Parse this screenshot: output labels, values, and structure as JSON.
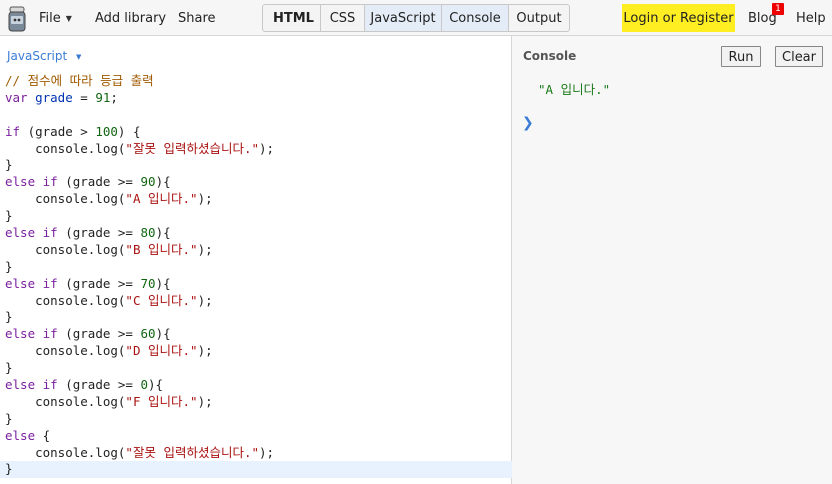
{
  "menu": {
    "file": "File",
    "add_library": "Add library",
    "share": "Share",
    "login": "Login or Register",
    "blog": "Blog",
    "blog_badge": "1",
    "help": "Help"
  },
  "tabs": [
    {
      "label": "HTML"
    },
    {
      "label": "CSS"
    },
    {
      "label": "JavaScript"
    },
    {
      "label": "Console"
    },
    {
      "label": "Output"
    }
  ],
  "editor": {
    "language": "JavaScript",
    "lines": [
      [
        {
          "t": "cm",
          "v": "// 점수에 따라 등급 출력"
        }
      ],
      [
        {
          "t": "kw",
          "v": "var"
        },
        {
          "t": "",
          "v": " "
        },
        {
          "t": "var",
          "v": "grade"
        },
        {
          "t": "",
          "v": " = "
        },
        {
          "t": "num",
          "v": "91"
        },
        {
          "t": "",
          "v": ";"
        }
      ],
      [],
      [
        {
          "t": "kw",
          "v": "if"
        },
        {
          "t": "",
          "v": " (grade > "
        },
        {
          "t": "num",
          "v": "100"
        },
        {
          "t": "",
          "v": ") {"
        }
      ],
      [
        {
          "t": "",
          "v": "    console.log("
        },
        {
          "t": "str",
          "v": "\"잘못 입력하셨습니다.\""
        },
        {
          "t": "",
          "v": ");"
        }
      ],
      [
        {
          "t": "",
          "v": "}"
        }
      ],
      [
        {
          "t": "kw",
          "v": "else"
        },
        {
          "t": "",
          "v": " "
        },
        {
          "t": "kw",
          "v": "if"
        },
        {
          "t": "",
          "v": " (grade >= "
        },
        {
          "t": "num",
          "v": "90"
        },
        {
          "t": "",
          "v": "){"
        }
      ],
      [
        {
          "t": "",
          "v": "    console.log("
        },
        {
          "t": "str",
          "v": "\"A 입니다.\""
        },
        {
          "t": "",
          "v": ");"
        }
      ],
      [
        {
          "t": "",
          "v": "}"
        }
      ],
      [
        {
          "t": "kw",
          "v": "else"
        },
        {
          "t": "",
          "v": " "
        },
        {
          "t": "kw",
          "v": "if"
        },
        {
          "t": "",
          "v": " (grade >= "
        },
        {
          "t": "num",
          "v": "80"
        },
        {
          "t": "",
          "v": "){"
        }
      ],
      [
        {
          "t": "",
          "v": "    console.log("
        },
        {
          "t": "str",
          "v": "\"B 입니다.\""
        },
        {
          "t": "",
          "v": ");"
        }
      ],
      [
        {
          "t": "",
          "v": "}"
        }
      ],
      [
        {
          "t": "kw",
          "v": "else"
        },
        {
          "t": "",
          "v": " "
        },
        {
          "t": "kw",
          "v": "if"
        },
        {
          "t": "",
          "v": " (grade >= "
        },
        {
          "t": "num",
          "v": "70"
        },
        {
          "t": "",
          "v": "){"
        }
      ],
      [
        {
          "t": "",
          "v": "    console.log("
        },
        {
          "t": "str",
          "v": "\"C 입니다.\""
        },
        {
          "t": "",
          "v": ");"
        }
      ],
      [
        {
          "t": "",
          "v": "}"
        }
      ],
      [
        {
          "t": "kw",
          "v": "else"
        },
        {
          "t": "",
          "v": " "
        },
        {
          "t": "kw",
          "v": "if"
        },
        {
          "t": "",
          "v": " (grade >= "
        },
        {
          "t": "num",
          "v": "60"
        },
        {
          "t": "",
          "v": "){"
        }
      ],
      [
        {
          "t": "",
          "v": "    console.log("
        },
        {
          "t": "str",
          "v": "\"D 입니다.\""
        },
        {
          "t": "",
          "v": ");"
        }
      ],
      [
        {
          "t": "",
          "v": "}"
        }
      ],
      [
        {
          "t": "kw",
          "v": "else"
        },
        {
          "t": "",
          "v": " "
        },
        {
          "t": "kw",
          "v": "if"
        },
        {
          "t": "",
          "v": " (grade >= "
        },
        {
          "t": "num",
          "v": "0"
        },
        {
          "t": "",
          "v": "){"
        }
      ],
      [
        {
          "t": "",
          "v": "    console.log("
        },
        {
          "t": "str",
          "v": "\"F 입니다.\""
        },
        {
          "t": "",
          "v": ");"
        }
      ],
      [
        {
          "t": "",
          "v": "}"
        }
      ],
      [
        {
          "t": "kw",
          "v": "else"
        },
        {
          "t": "",
          "v": " {"
        }
      ],
      [
        {
          "t": "",
          "v": "    console.log("
        },
        {
          "t": "str",
          "v": "\"잘못 입력하셨습니다.\""
        },
        {
          "t": "",
          "v": ");"
        }
      ],
      [
        {
          "t": "",
          "v": "}"
        }
      ]
    ]
  },
  "console": {
    "title": "Console",
    "run": "Run",
    "clear": "Clear",
    "output": "\"A 입니다.\"",
    "prompt": "❯"
  }
}
